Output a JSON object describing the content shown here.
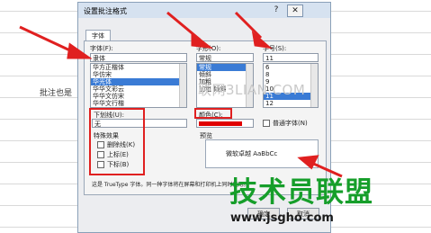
{
  "background": {
    "cell_text": "批注也是"
  },
  "dialog": {
    "title": "设置批注格式",
    "help": "?",
    "close": "✕",
    "tab": "字体",
    "font_label": "字体(F):",
    "font_value": "隶体",
    "font_list": [
      "华方正楷体",
      "华仿宋",
      "华光体",
      "华华文彩云",
      "华华文仿宋",
      "华华文行楷"
    ],
    "font_selected_index": 2,
    "style_label": "字形(O):",
    "style_value": "常规",
    "style_list": [
      "常规",
      "倾斜",
      "加粗",
      "加粗 倾斜"
    ],
    "style_selected_index": 0,
    "size_label": "字号(S):",
    "size_value": "11",
    "size_list": [
      "6",
      "8",
      "9",
      "10",
      "11",
      "12"
    ],
    "size_selected_index": 4,
    "underline_label": "下划线(U):",
    "underline_value": "无",
    "color_label": "颜色(C):",
    "color_swatch": "#e00000",
    "normal_font_label": "普通字体(N)",
    "effects_label": "特殊效果",
    "effects": [
      "删除线(K)",
      "上标(E)",
      "下标(B)"
    ],
    "preview_label": "预览",
    "preview_text": "微软卓越  AaBbCc",
    "note": "这是 TrueType 字体。同一种字体将在屏幕和打印机上同时使用。",
    "ok_label": "确定",
    "cancel_label": "取消"
  },
  "watermarks": {
    "faint": "联网3LIAN.COM",
    "brand": "技术员联盟",
    "url": "www.jsgho.com"
  },
  "colors": {
    "annotation": "#e02020",
    "brand_green": "#169e2a"
  }
}
